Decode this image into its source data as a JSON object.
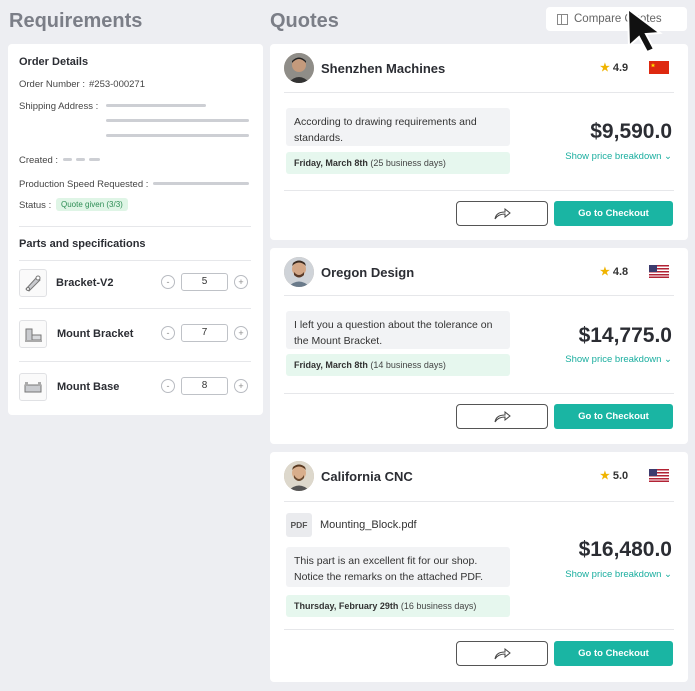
{
  "headings": {
    "requirements": "Requirements",
    "quotes": "Quotes"
  },
  "compare_button": {
    "label": "Compare",
    "label_hidden_part": "Quotes"
  },
  "order_details": {
    "title": "Order Details",
    "order_number_label": "Order Number :",
    "order_number": "#253-000271",
    "shipping_label": "Shipping Address :",
    "created_label": "Created :",
    "speed_label": "Production Speed Requested :",
    "status_label": "Status :",
    "status_value": "Quote given (3/3)"
  },
  "parts": {
    "title": "Parts and specifications",
    "items": [
      {
        "name": "Bracket-V2",
        "quantity": "5"
      },
      {
        "name": "Mount Bracket",
        "quantity": "7"
      },
      {
        "name": "Mount Base",
        "quantity": "8"
      }
    ],
    "minus": "-",
    "plus": "+"
  },
  "quotes": [
    {
      "vendor": "Shenzhen Machines",
      "rating": "4.9",
      "country_flag": "china-flag",
      "message": "According to drawing requirements and standards.",
      "date": "Friday, March 8th",
      "business_days": "(25 business days)",
      "price": "$9,590.0",
      "breakdown": "Show price breakdown",
      "checkout": "Go to Checkout"
    },
    {
      "vendor": "Oregon Design",
      "rating": "4.8",
      "country_flag": "us-flag",
      "message": "I left you a question about the tolerance on the Mount Bracket.",
      "date": "Friday, March 8th",
      "business_days": "(14 business days)",
      "price": "$14,775.0",
      "breakdown": "Show price breakdown",
      "checkout": "Go to Checkout"
    },
    {
      "vendor": "California CNC",
      "rating": "5.0",
      "country_flag": "us-flag",
      "attachment_type": "PDF",
      "attachment": "Mounting_Block.pdf",
      "message": "This part is an excellent fit for our shop. Notice the remarks on the attached PDF.",
      "date": "Thursday, February 29th",
      "business_days": "(16 business days)",
      "price": "$16,480.0",
      "breakdown": "Show price breakdown",
      "checkout": "Go to Checkout"
    }
  ],
  "colors": {
    "accent": "#1ab5a3",
    "star": "#f0b400",
    "status_bg": "#dff5e6"
  }
}
